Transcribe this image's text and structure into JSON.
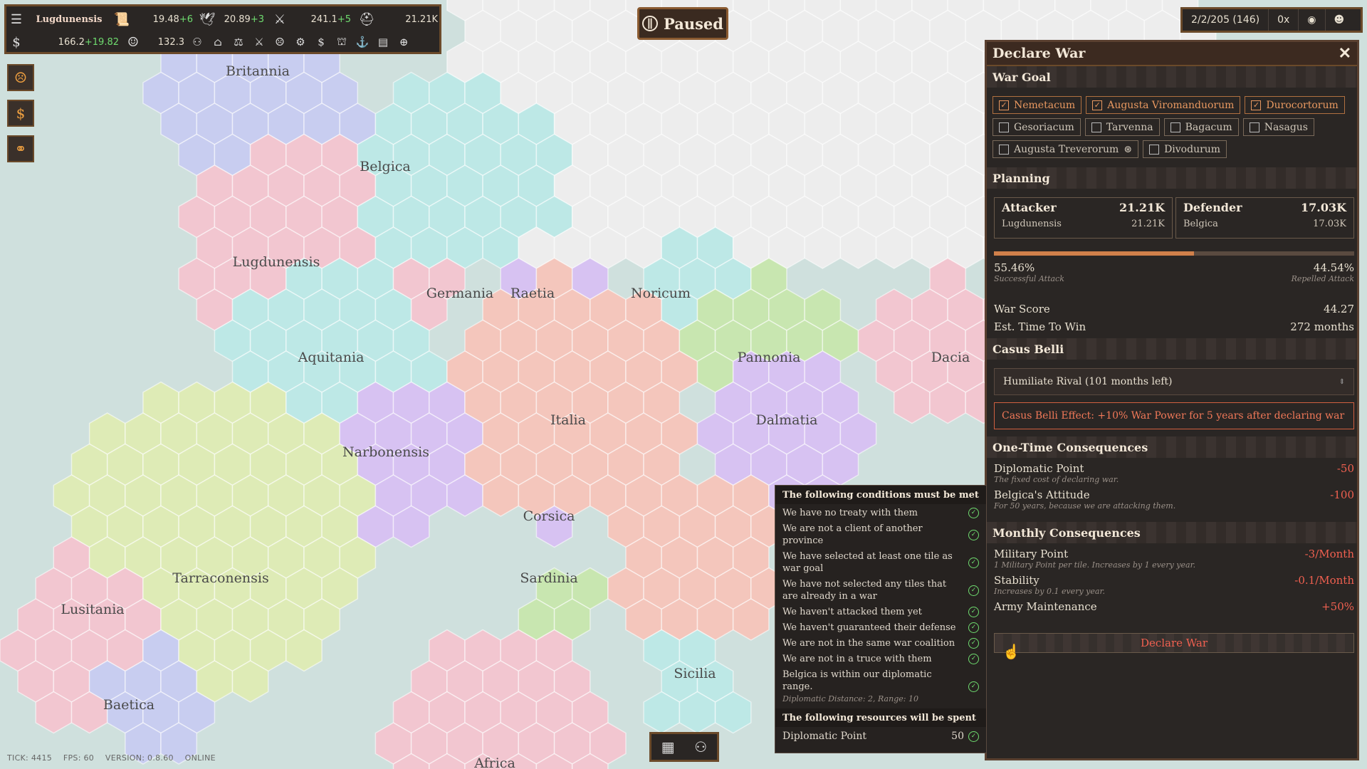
{
  "topbar": {
    "province": "Lugdunensis",
    "stat1": {
      "base": "19.48",
      "delta": "+6"
    },
    "stat2": {
      "base": "20.89",
      "delta": "+3"
    },
    "stat3": {
      "base": "241.1",
      "delta": "+5"
    },
    "stat4": "21.21K",
    "money": {
      "base": "166.2",
      "delta": "+19.82"
    },
    "stat5": "132.3"
  },
  "status": {
    "label": "Paused"
  },
  "topright": {
    "date": "2/2/205 (146)",
    "speed": "0x"
  },
  "map_labels": [
    "Britannia",
    "Belgica",
    "Lugdunensis",
    "Germania",
    "Raetia",
    "Noricum",
    "Aquitania",
    "Pannonia",
    "Dacia",
    "Italia",
    "Dalmatia",
    "Narbonensis",
    "Corsica",
    "Tarraconensis",
    "Sardinia",
    "Lusitania",
    "Baetica",
    "Sicilia",
    "Africa"
  ],
  "panel": {
    "title": "Declare War",
    "war_goal_title": "War Goal",
    "goals": [
      {
        "name": "Nemetacum",
        "checked": true
      },
      {
        "name": "Augusta Viromanduorum",
        "checked": true
      },
      {
        "name": "Durocortorum",
        "checked": true
      },
      {
        "name": "Gesoriacum",
        "checked": false
      },
      {
        "name": "Tarvenna",
        "checked": false
      },
      {
        "name": "Bagacum",
        "checked": false
      },
      {
        "name": "Nasagus",
        "checked": false
      },
      {
        "name": "Augusta Treverorum",
        "checked": false
      },
      {
        "name": "Divodurum",
        "checked": false
      }
    ],
    "planning_title": "Planning",
    "attacker": {
      "label": "Attacker",
      "total": "21.21K",
      "name": "Lugdunensis",
      "value": "21.21K"
    },
    "defender": {
      "label": "Defender",
      "total": "17.03K",
      "name": "Belgica",
      "value": "17.03K"
    },
    "success_pct": "55.46%",
    "success_label": "Successful Attack",
    "repel_pct": "44.54%",
    "repel_label": "Repelled Attack",
    "success_fraction": 0.5546,
    "war_score_label": "War Score",
    "war_score": "44.27",
    "time_label": "Est. Time To Win",
    "time_value": "272 months",
    "casus_belli_title": "Casus Belli",
    "casus_belli_selected": "Humiliate Rival (101 months left)",
    "casus_belli_effect": "Casus Belli Effect: +10% War Power for 5 years after declaring war",
    "one_time_title": "One-Time Consequences",
    "one_time": [
      {
        "label": "Diplomatic Point",
        "desc": "The fixed cost of declaring war.",
        "value": "-50"
      },
      {
        "label": "Belgica's Attitude",
        "desc": "For 50 years, because we are attacking them.",
        "value": "-100"
      }
    ],
    "monthly_title": "Monthly Consequences",
    "monthly": [
      {
        "label": "Military Point",
        "desc": "1 Military Point per tile. Increases by 1 every year.",
        "value": "-3/Month"
      },
      {
        "label": "Stability",
        "desc": "Increases by 0.1 every year.",
        "value": "-0.1/Month"
      },
      {
        "label": "Army Maintenance",
        "desc": "",
        "value": "+50%"
      }
    ],
    "declare_button": "Declare War"
  },
  "conditions": {
    "title": "The following conditions must be met",
    "items": [
      "We have no treaty with them",
      "We are not a client of another province",
      "We have selected at least one tile as war goal",
      "We have not selected any tiles that are already in a war",
      "We haven't attacked them yet",
      "We haven't guaranteed their defense",
      "We are not in the same war coalition",
      "We are not in a truce with them",
      "Belgica is within our diplomatic range."
    ],
    "distance_note": "Diplomatic Distance: 2, Range: 10",
    "resources_title": "The following resources will be spent",
    "resource": {
      "label": "Diplomatic Point",
      "value": "50"
    }
  },
  "footer": {
    "tick": "TICK: 4415",
    "fps": "FPS: 60",
    "version": "VERSION: 0.8.60",
    "online": "ONLINE"
  },
  "colors": {
    "panel_bg": "#2a2624",
    "accent_border": "#6b4a2a",
    "negative": "#f06050",
    "positive": "#6fdc6f",
    "checked": "#e89860"
  }
}
